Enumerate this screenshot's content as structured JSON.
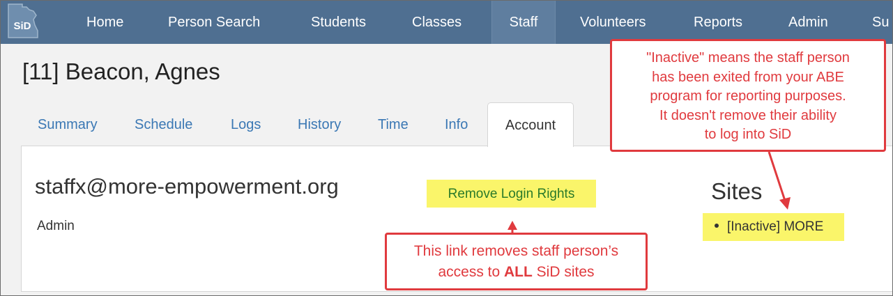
{
  "navbar": {
    "logo_text": "SiD",
    "items": [
      {
        "label": "Home"
      },
      {
        "label": "Person Search"
      },
      {
        "label": "Students"
      },
      {
        "label": "Classes"
      },
      {
        "label": "Staff",
        "active": true
      },
      {
        "label": "Volunteers"
      },
      {
        "label": "Reports"
      },
      {
        "label": "Admin"
      },
      {
        "label": "Su"
      }
    ]
  },
  "page": {
    "title": "[11] Beacon, Agnes"
  },
  "tabs": [
    {
      "label": "Summary"
    },
    {
      "label": "Schedule"
    },
    {
      "label": "Logs"
    },
    {
      "label": "History"
    },
    {
      "label": "Time"
    },
    {
      "label": "Info"
    },
    {
      "label": "Account",
      "active": true
    }
  ],
  "account": {
    "email": "staffx@more-empowerment.org",
    "role": "Admin",
    "remove_login_label": "Remove Login Rights",
    "sites_heading": "Sites",
    "sites": [
      {
        "label": "[Inactive] MORE"
      }
    ]
  },
  "annotations": {
    "inactive_note": {
      "line1": "\"Inactive\" means the staff person",
      "line2": "has been exited from your ABE",
      "line3": "program for reporting purposes.",
      "line4": "It doesn't remove their ability",
      "line5": "to log into SiD"
    },
    "remove_note": {
      "line1": "This link removes staff person’s",
      "line2_before": "access to ",
      "line2_bold": "ALL",
      "line2_after": " SiD sites"
    }
  },
  "colors": {
    "navbar_bg": "#4f6f91",
    "link_blue": "#3b78b4",
    "highlight_yellow": "#faf56a",
    "annotation_red": "#e03a3e",
    "remove_link_green": "#2a7a2a"
  },
  "icons": {
    "logo": "minnesota-state-logo-icon",
    "bullet": "bullet-icon",
    "arrows": "annotation-arrow-icon"
  }
}
